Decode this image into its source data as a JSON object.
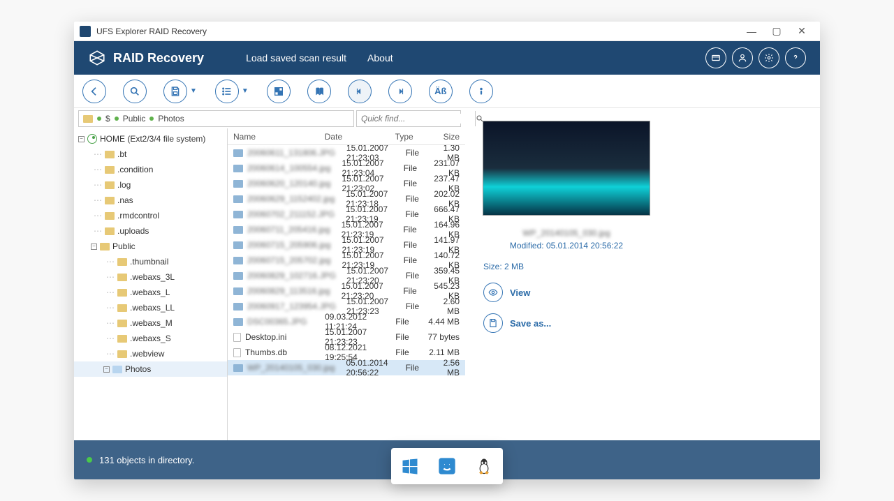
{
  "titlebar": {
    "title": "UFS Explorer RAID Recovery"
  },
  "banner": {
    "brand": "RAID Recovery",
    "menu1": "Load saved scan result",
    "menu2": "About"
  },
  "breadcrumb": {
    "root": "$",
    "p1": "Public",
    "p2": "Photos"
  },
  "quickfind": {
    "placeholder": "Quick find..."
  },
  "tree": {
    "root": "HOME (Ext2/3/4 file system)",
    "items": [
      ".bt",
      ".condition",
      ".log",
      ".nas",
      ".rmdcontrol",
      ".uploads",
      "Public"
    ],
    "public_items": [
      ".thumbnail",
      ".webaxs_3L",
      ".webaxs_L",
      ".webaxs_LL",
      ".webaxs_M",
      ".webaxs_S",
      ".webview",
      "Photos"
    ]
  },
  "columns": {
    "name": "Name",
    "date": "Date",
    "type": "Type",
    "size": "Size"
  },
  "files": [
    {
      "name": "20060611_131806.JPG",
      "date": "15.01.2007 21:23:03",
      "type": "File",
      "size": "1.30 MB"
    },
    {
      "name": "20060614_100554.jpg",
      "date": "15.01.2007 21:23:04",
      "type": "File",
      "size": "231.07 KB"
    },
    {
      "name": "20060620_120140.jpg",
      "date": "15.01.2007 21:23:02",
      "type": "File",
      "size": "237.47 KB"
    },
    {
      "name": "20060629_1152402.jpg",
      "date": "15.01.2007 21:23:18",
      "type": "File",
      "size": "202.02 KB"
    },
    {
      "name": "20060702_211152.JPG",
      "date": "15.01.2007 21:23:19",
      "type": "File",
      "size": "666.47 KB"
    },
    {
      "name": "20060711_205416.jpg",
      "date": "15.01.2007 21:23:19",
      "type": "File",
      "size": "164.96 KB"
    },
    {
      "name": "20060715_205906.jpg",
      "date": "15.01.2007 21:23:19",
      "type": "File",
      "size": "141.97 KB"
    },
    {
      "name": "20060715_205702.jpg",
      "date": "15.01.2007 21:23:19",
      "type": "File",
      "size": "140.72 KB"
    },
    {
      "name": "20060829_102716.JPG",
      "date": "15.01.2007 21:23:20",
      "type": "File",
      "size": "359.45 KB"
    },
    {
      "name": "20060829_113516.jpg",
      "date": "15.01.2007 21:23:20",
      "type": "File",
      "size": "545.23 KB"
    },
    {
      "name": "20060917_123954.JPG",
      "date": "15.01.2007 21:23:23",
      "type": "File",
      "size": "2.60 MB"
    },
    {
      "name": "DSC00365.JPG",
      "date": "09.03.2012 11:21:24",
      "type": "File",
      "size": "4.44 MB"
    },
    {
      "name": "Desktop.ini",
      "date": "15.01.2007 21:23:23",
      "type": "File",
      "size": "77 bytes",
      "clear": true,
      "fileicon": true
    },
    {
      "name": "Thumbs.db",
      "date": "08.12.2021 19:25:54",
      "type": "File",
      "size": "2.11 MB",
      "clear": true,
      "fileicon": true
    },
    {
      "name": "WP_20140105_030.jpg",
      "date": "05.01.2014 20:56:22",
      "type": "File",
      "size": "2.56 MB",
      "selected": true
    }
  ],
  "preview": {
    "filename": "WP_20140105_030.jpg",
    "modified": "Modified: 05.01.2014 20:56:22",
    "size": "Size: 2 MB",
    "view": "View",
    "saveas": "Save as..."
  },
  "status": {
    "text": "131 objects in directory."
  }
}
